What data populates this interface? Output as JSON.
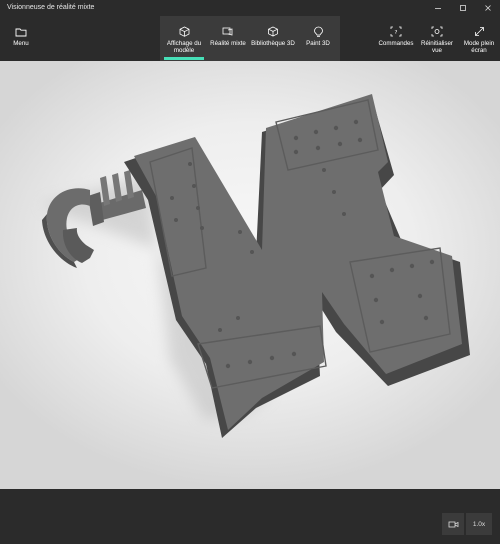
{
  "window": {
    "title": "Visionneuse de réalité mixte",
    "controls": [
      "minimize-icon",
      "maximize-icon",
      "close-icon"
    ]
  },
  "toolbar": {
    "menu": {
      "label": "Menu",
      "icon": "folder-icon"
    },
    "tabs": [
      {
        "label": "Affichage du modèle",
        "icon": "cube-icon",
        "active": true
      },
      {
        "label": "Réalité mixte",
        "icon": "mixed-reality-icon",
        "active": false
      },
      {
        "label": "Bibliothèque 3D",
        "icon": "library-cube-icon",
        "active": false
      },
      {
        "label": "Paint 3D",
        "icon": "paint-icon",
        "active": false
      }
    ],
    "right": [
      {
        "label": "Commandes",
        "icon": "commands-icon"
      },
      {
        "label": "Réinitialiser vue",
        "icon": "reset-view-icon"
      },
      {
        "label": "Mode plein écran",
        "icon": "fullscreen-icon"
      }
    ]
  },
  "viewport": {
    "model": "3D letter N with wrench"
  },
  "bottom": {
    "view_icon": "camera-view-icon",
    "zoom": "1.0x"
  },
  "colors": {
    "accent": "#47e0b8",
    "bar": "#2b2b2b",
    "tab_group": "#3b3b3b",
    "model": "#6e6e6e"
  }
}
